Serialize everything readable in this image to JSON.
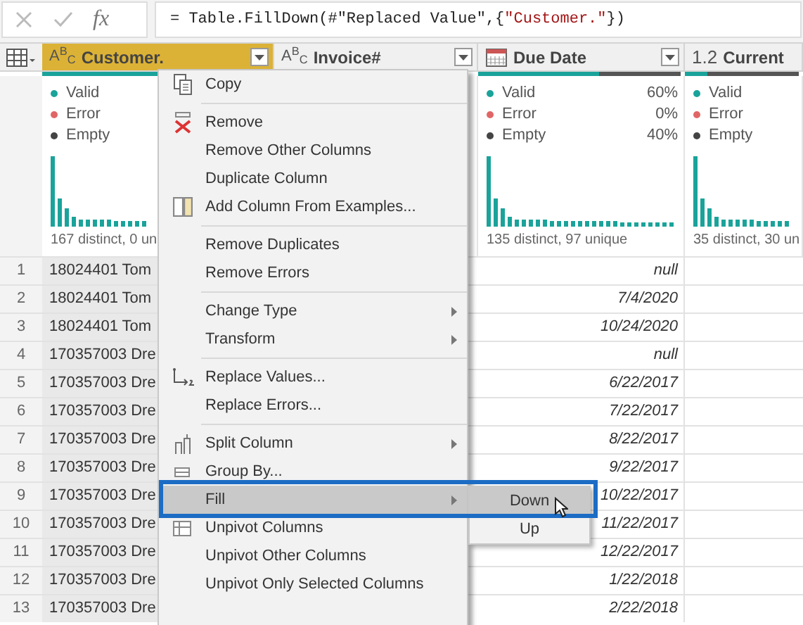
{
  "formula_bar": {
    "fx_label": "fx",
    "formula": [
      {
        "kind": "plain",
        "text": "= Table.FillDown(#\"Replaced Value\",{"
      },
      {
        "kind": "string",
        "text": "\"Customer.\""
      },
      {
        "kind": "plain",
        "text": "})"
      }
    ]
  },
  "columns": [
    {
      "name": "Customer.",
      "kind": "text",
      "type_label": "A$^{B}$$_{C}$",
      "selected": true,
      "quality": {
        "level": 1
      },
      "legend": [
        {
          "label": "Valid",
          "color": "#1aa39a"
        },
        {
          "label": "Error",
          "color": "#e06666"
        },
        {
          "label": "Empty",
          "color": "#444444"
        }
      ],
      "distinct": "167 distinct, 0 un"
    },
    {
      "name": "Invoice#",
      "kind": "text",
      "type_label": "A$^{B}$$_{C}$",
      "selected": false
    },
    {
      "name": "Due Date",
      "kind": "date",
      "selected": false,
      "quality": {
        "level": 0.6
      },
      "legend": [
        {
          "label": "Valid",
          "color": "#1aa39a",
          "value": "60%"
        },
        {
          "label": "Error",
          "color": "#e06666",
          "value": "0%"
        },
        {
          "label": "Empty",
          "color": "#444444",
          "value": "40%"
        }
      ],
      "distinct": "135 distinct, 97 unique"
    },
    {
      "name": "Current",
      "kind": "decimal",
      "type_label": "1.2",
      "selected": false,
      "quality": {
        "level": 0.2
      },
      "legend": [
        {
          "label": "Valid",
          "color": "#1aa39a"
        },
        {
          "label": "Error",
          "color": "#e06666"
        },
        {
          "label": "Empty",
          "color": "#444444"
        }
      ],
      "distinct": "35 distinct, 30 un"
    }
  ],
  "rows": [
    {
      "number": "1",
      "customer": "18024401 Tom",
      "due_date": "null"
    },
    {
      "number": "2",
      "customer": "18024401 Tom",
      "due_date": "7/4/2020"
    },
    {
      "number": "3",
      "customer": "18024401 Tom",
      "due_date": "10/24/2020"
    },
    {
      "number": "4",
      "customer": "170357003 Dre",
      "due_date": "null"
    },
    {
      "number": "5",
      "customer": "170357003 Dre",
      "due_date": "6/22/2017"
    },
    {
      "number": "6",
      "customer": "170357003 Dre",
      "due_date": "7/22/2017"
    },
    {
      "number": "7",
      "customer": "170357003 Dre",
      "due_date": "8/22/2017"
    },
    {
      "number": "8",
      "customer": "170357003 Dre",
      "due_date": "9/22/2017"
    },
    {
      "number": "9",
      "customer": "170357003 Dre",
      "due_date": "10/22/2017"
    },
    {
      "number": "10",
      "customer": "170357003 Dre",
      "due_date": "11/22/2017"
    },
    {
      "number": "11",
      "customer": "170357003 Dre",
      "due_date": "12/22/2017"
    },
    {
      "number": "12",
      "customer": "170357003 Dre",
      "due_date": "1/22/2018"
    },
    {
      "number": "13",
      "customer": "170357003 Dre",
      "due_date": "2/22/2018"
    }
  ],
  "context_menu": {
    "items": [
      {
        "kind": "item",
        "label": "Copy",
        "submenu": false,
        "selected": false
      },
      {
        "kind": "separator"
      },
      {
        "kind": "item",
        "label": "Remove",
        "submenu": false,
        "selected": false
      },
      {
        "kind": "item",
        "label": "Remove Other Columns",
        "submenu": false,
        "selected": false
      },
      {
        "kind": "item",
        "label": "Duplicate Column",
        "submenu": false,
        "selected": false
      },
      {
        "kind": "item",
        "label": "Add Column From Examples...",
        "submenu": false,
        "selected": false
      },
      {
        "kind": "separator"
      },
      {
        "kind": "item",
        "label": "Remove Duplicates",
        "submenu": false,
        "selected": false
      },
      {
        "kind": "item",
        "label": "Remove Errors",
        "submenu": false,
        "selected": false
      },
      {
        "kind": "separator"
      },
      {
        "kind": "item",
        "label": "Change Type",
        "submenu": true,
        "selected": false
      },
      {
        "kind": "item",
        "label": "Transform",
        "submenu": true,
        "selected": false
      },
      {
        "kind": "separator"
      },
      {
        "kind": "item",
        "label": "Replace Values...",
        "submenu": false,
        "selected": false
      },
      {
        "kind": "item",
        "label": "Replace Errors...",
        "submenu": false,
        "selected": false
      },
      {
        "kind": "separator"
      },
      {
        "kind": "item",
        "label": "Split Column",
        "submenu": true,
        "selected": false
      },
      {
        "kind": "item",
        "label": "Group By...",
        "submenu": false,
        "selected": false
      },
      {
        "kind": "item",
        "label": "Fill",
        "submenu": true,
        "selected": true
      },
      {
        "kind": "item",
        "label": "Unpivot Columns",
        "submenu": false,
        "selected": false
      },
      {
        "kind": "item",
        "label": "Unpivot Other Columns",
        "submenu": false,
        "selected": false
      },
      {
        "kind": "item",
        "label": "Unpivot Only Selected Columns",
        "submenu": false,
        "selected": false
      }
    ]
  },
  "submenu": {
    "items": [
      {
        "label": "Down",
        "selected": true
      },
      {
        "label": "Up",
        "selected": false
      }
    ]
  }
}
